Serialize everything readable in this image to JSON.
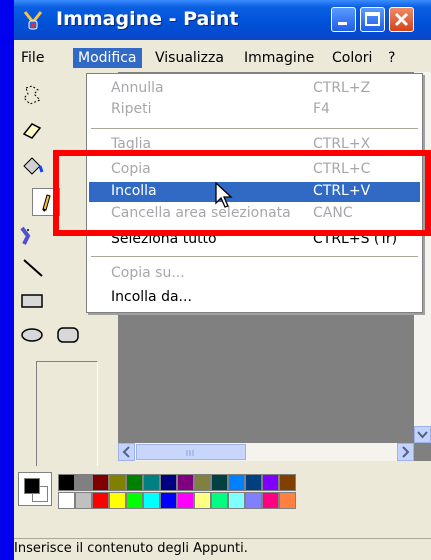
{
  "window": {
    "title": "Immagine - Paint",
    "app_icon": "paint-icon",
    "controls": [
      "minimize-icon",
      "maximize-icon",
      "close-icon"
    ]
  },
  "menubar": {
    "items": [
      "File",
      "Modifica",
      "Visualizza",
      "Immagine",
      "Colori",
      "?"
    ],
    "active": "Modifica"
  },
  "menu": {
    "annulla": {
      "label": "Annulla",
      "shortcut": "CTRL+Z"
    },
    "ripeti": {
      "label": "Ripeti",
      "shortcut": "F4"
    },
    "taglia": {
      "label": "Taglia",
      "shortcut": "CTRL+X"
    },
    "copia": {
      "label": "Copia",
      "shortcut": "CTRL+C"
    },
    "incolla": {
      "label": "Incolla",
      "shortcut": "CTRL+V"
    },
    "cancella": {
      "label": "Cancella area selezionata",
      "shortcut": "CANC"
    },
    "seleziona": {
      "label": "Seleziona tutto",
      "shortcut": "CTRL+S (Tr)"
    },
    "copia_su": {
      "label": "Copia su..."
    },
    "incolla_da": {
      "label": "Incolla da..."
    }
  },
  "tools": [
    "free-select-icon",
    "eraser-icon",
    "fill-icon",
    "pencil-icon",
    "airbrush-icon",
    "line-icon",
    "rectangle-icon",
    "ellipse-icon",
    "rounded-rectangle-icon"
  ],
  "palette": {
    "primary_color": "#000000",
    "secondary_color": "#ffffff",
    "colors_top": [
      "#000000",
      "#808080",
      "#800000",
      "#808000",
      "#008000",
      "#008080",
      "#000080",
      "#800080",
      "#808040",
      "#004040",
      "#0080ff",
      "#004080",
      "#8000ff",
      "#804000"
    ],
    "colors_bottom": [
      "#ffffff",
      "#c0c0c0",
      "#ff0000",
      "#ffff00",
      "#00ff00",
      "#00ffff",
      "#0000ff",
      "#ff00ff",
      "#ffff80",
      "#00ff80",
      "#80ffff",
      "#8080ff",
      "#ff0080",
      "#ff8040"
    ]
  },
  "status": {
    "text": "Inserisce il contenuto degli Appunti."
  },
  "theme": {
    "titlebar": "#0050d8",
    "menu_highlight": "#316ac5",
    "callout_box": "#ff0000",
    "disabled_text": "#a7a6aa"
  }
}
